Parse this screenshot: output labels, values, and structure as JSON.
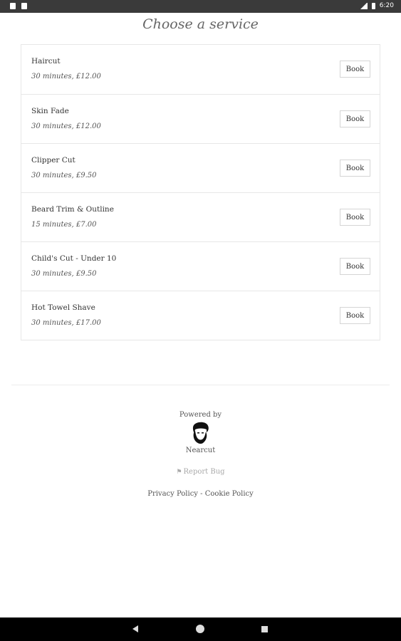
{
  "status_bar": {
    "time": "6:20"
  },
  "page": {
    "title": "Choose a service"
  },
  "services": [
    {
      "name": "Haircut",
      "meta": "30 minutes, £12.00",
      "action": "Book"
    },
    {
      "name": "Skin Fade",
      "meta": "30 minutes, £12.00",
      "action": "Book"
    },
    {
      "name": "Clipper Cut",
      "meta": "30 minutes, £9.50",
      "action": "Book"
    },
    {
      "name": "Beard Trim & Outline",
      "meta": "15 minutes, £7.00",
      "action": "Book"
    },
    {
      "name": "Child's Cut - Under 10",
      "meta": "30 minutes, £9.50",
      "action": "Book"
    },
    {
      "name": "Hot Towel Shave",
      "meta": "30 minutes, £17.00",
      "action": "Book"
    }
  ],
  "footer": {
    "powered_by": "Powered by",
    "brand": "Nearcut",
    "report_bug": "Report Bug",
    "privacy": "Privacy Policy",
    "separator": "-",
    "cookie": "Cookie Policy"
  }
}
